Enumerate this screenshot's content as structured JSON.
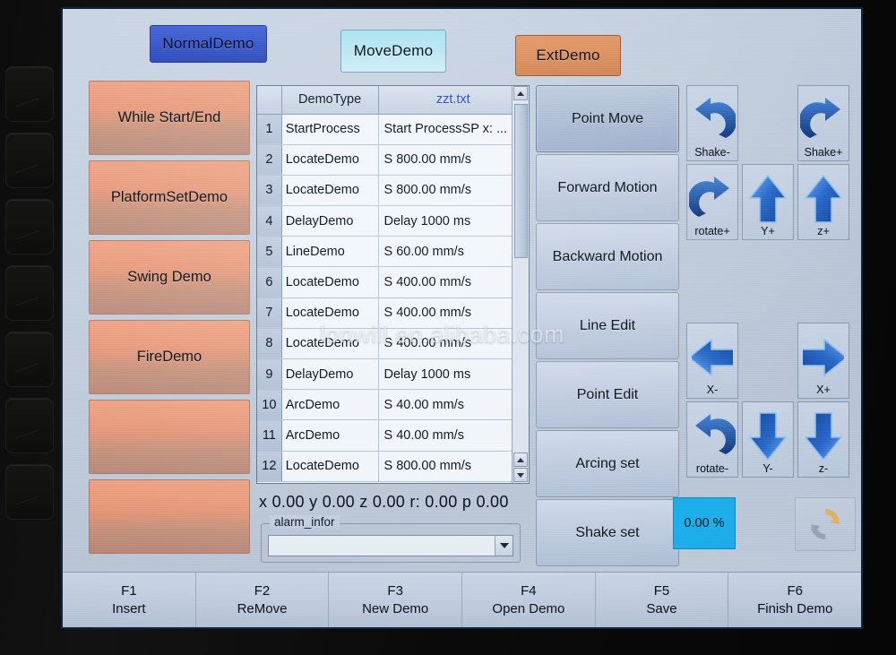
{
  "tabs": [
    {
      "label": "NormalDemo",
      "name": "tab-normal-demo"
    },
    {
      "label": "MoveDemo",
      "name": "tab-move-demo"
    },
    {
      "label": "ExtDemo",
      "name": "tab-ext-demo"
    }
  ],
  "demo_buttons": [
    {
      "label": "While Start/End"
    },
    {
      "label": "PlatformSetDemo"
    },
    {
      "label": "Swing Demo"
    },
    {
      "label": "FireDemo"
    },
    {
      "label": ""
    },
    {
      "label": ""
    }
  ],
  "grid": {
    "headers": {
      "index": "",
      "type": "DemoType",
      "file": "zzt.txt"
    },
    "rows": [
      {
        "i": "1",
        "type": "StartProcess",
        "value": "Start ProcessSP x: ..."
      },
      {
        "i": "2",
        "type": "LocateDemo",
        "value": "S 800.00 mm/s"
      },
      {
        "i": "3",
        "type": "LocateDemo",
        "value": "S 800.00 mm/s"
      },
      {
        "i": "4",
        "type": "DelayDemo",
        "value": "Delay 1000 ms"
      },
      {
        "i": "5",
        "type": "LineDemo",
        "value": "S  60.00 mm/s"
      },
      {
        "i": "6",
        "type": "LocateDemo",
        "value": "S 400.00 mm/s"
      },
      {
        "i": "7",
        "type": "LocateDemo",
        "value": "S 400.00 mm/s"
      },
      {
        "i": "8",
        "type": "LocateDemo",
        "value": "S 400.00 mm/s"
      },
      {
        "i": "9",
        "type": "DelayDemo",
        "value": "Delay 1000 ms"
      },
      {
        "i": "10",
        "type": "ArcDemo",
        "value": "S  40.00 mm/s"
      },
      {
        "i": "11",
        "type": "ArcDemo",
        "value": "S  40.00 mm/s"
      },
      {
        "i": "12",
        "type": "LocateDemo",
        "value": "S 800.00 mm/s"
      }
    ]
  },
  "status": {
    "coordinates": "x 0.00 y 0.00 z 0.00 r: 0.00 p 0.00",
    "alarm_legend": "alarm_infor",
    "alarm_value": "",
    "speed": "0.00  %"
  },
  "commands": [
    {
      "label": "Point Move",
      "selected": true
    },
    {
      "label": "Forward Motion",
      "selected": false
    },
    {
      "label": "Backward Motion",
      "selected": false
    },
    {
      "label": "Line Edit",
      "selected": false
    },
    {
      "label": "Point Edit",
      "selected": false
    },
    {
      "label": "Arcing set",
      "selected": false
    },
    {
      "label": "Shake set",
      "selected": false
    }
  ],
  "jog": [
    {
      "label": "Shake-",
      "icon": "rotate-ccw-icon"
    },
    {
      "label": "",
      "icon": ""
    },
    {
      "label": "Shake+",
      "icon": "rotate-cw-icon"
    },
    {
      "label": "rotate+",
      "icon": "rotate-cw-icon"
    },
    {
      "label": "Y+",
      "icon": "arrow-up-icon"
    },
    {
      "label": "z+",
      "icon": "arrow-up-icon"
    },
    {
      "label": "X-",
      "icon": "arrow-left-icon"
    },
    {
      "label": "",
      "icon": ""
    },
    {
      "label": "X+",
      "icon": "arrow-right-icon"
    },
    {
      "label": "rotate-",
      "icon": "rotate-ccw-icon"
    },
    {
      "label": "Y-",
      "icon": "arrow-down-icon"
    },
    {
      "label": "z-",
      "icon": "arrow-down-icon"
    }
  ],
  "reset_icon": "refresh-icon",
  "function_keys": [
    {
      "key": "F1",
      "label": "Insert"
    },
    {
      "key": "F2",
      "label": "ReMove"
    },
    {
      "key": "F3",
      "label": "New Demo"
    },
    {
      "key": "F4",
      "label": "Open Demo"
    },
    {
      "key": "F5",
      "label": "Save"
    },
    {
      "key": "F6",
      "label": "Finish Demo"
    }
  ],
  "watermark": "lonwill.en.alibaba.com",
  "colors": {
    "tab_normal": "#3f5ecf",
    "tab_move": "#b9e6f3",
    "tab_ext": "#dd9566",
    "demo_button": "#e9a184",
    "speed_box": "#1fb6ec",
    "arrow_blue": "#1e5fbd",
    "file_header": "#2b52b8"
  }
}
